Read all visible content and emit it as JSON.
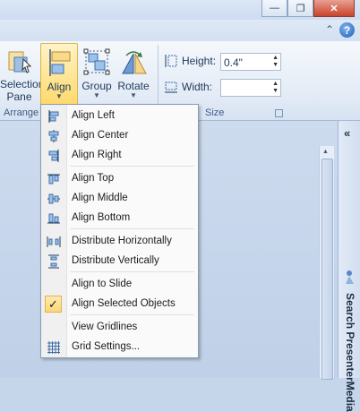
{
  "window": {
    "minimize_icon": "minimize-icon",
    "restore_icon": "restore-icon",
    "close_icon": "close-icon"
  },
  "ribbon": {
    "selection_pane": {
      "line1": "Selection",
      "line2": "Pane"
    },
    "align": {
      "label": "Align"
    },
    "group": {
      "label": "Group"
    },
    "rotate": {
      "label": "Rotate"
    },
    "groups": {
      "arrange": "Arrange",
      "size": "Size"
    },
    "size": {
      "height_label": "Height:",
      "height_value": "0.4\"",
      "width_label": "Width:",
      "width_value": ""
    }
  },
  "side_panel": {
    "title": "Search PresenterMedia"
  },
  "menu": {
    "items": [
      {
        "label": "Align Left",
        "icon": "align-left-icon"
      },
      {
        "label": "Align Center",
        "icon": "align-center-icon"
      },
      {
        "label": "Align Right",
        "icon": "align-right-icon"
      },
      {
        "label": "Align Top",
        "icon": "align-top-icon"
      },
      {
        "label": "Align Middle",
        "icon": "align-middle-icon"
      },
      {
        "label": "Align Bottom",
        "icon": "align-bottom-icon"
      },
      {
        "label": "Distribute Horizontally",
        "icon": "distribute-horizontally-icon"
      },
      {
        "label": "Distribute Vertically",
        "icon": "distribute-vertically-icon"
      },
      {
        "label": "Align to Slide",
        "icon": ""
      },
      {
        "label": "Align Selected Objects",
        "icon": "checkmark-icon",
        "checked": true
      },
      {
        "label": "View Gridlines",
        "icon": ""
      },
      {
        "label": "Grid Settings...",
        "icon": "grid-icon"
      }
    ]
  }
}
